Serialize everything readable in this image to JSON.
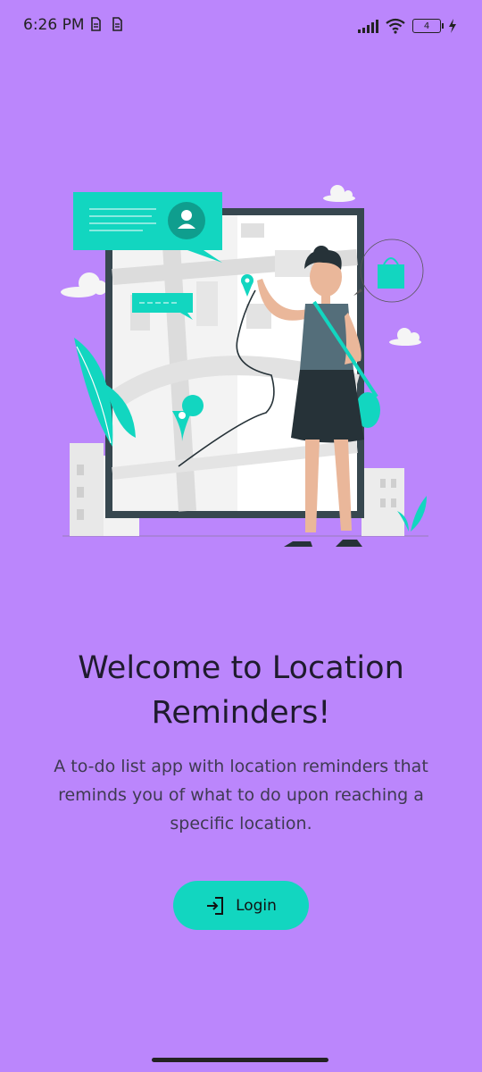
{
  "status_bar": {
    "time": "6:26 PM",
    "battery_level": "4",
    "icons": [
      "sim-icon",
      "sim-icon",
      "signal-icon",
      "wifi-icon",
      "battery-icon",
      "charging-icon"
    ]
  },
  "welcome": {
    "title": "Welcome to Location Reminders!",
    "description": "A to-do list app with location reminders that reminds you of what to do upon reaching a specific location."
  },
  "login_button": {
    "label": "Login",
    "icon": "login-icon",
    "color": "#12D6C0"
  },
  "colors": {
    "background": "#BB86FC",
    "accent": "#12D6C0"
  }
}
